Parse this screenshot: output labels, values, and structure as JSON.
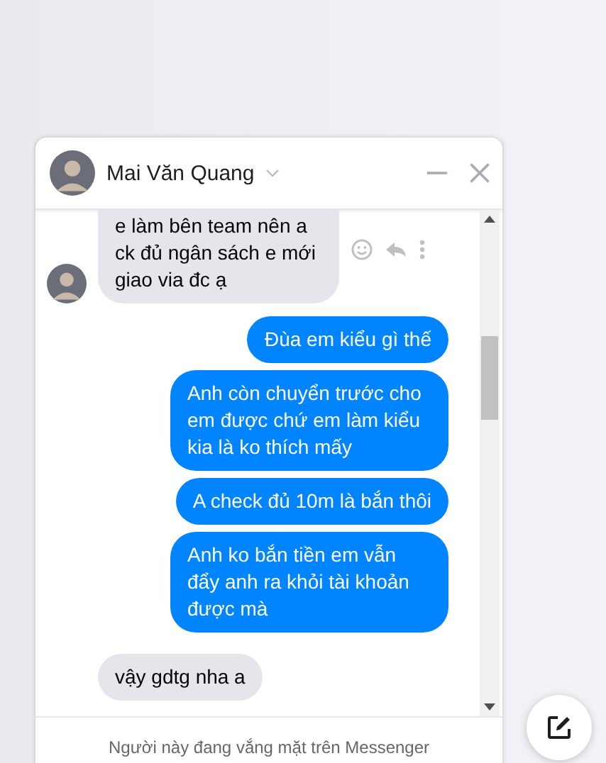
{
  "chat": {
    "contact_name": "Mai Văn Quang"
  },
  "messages": [
    {
      "kind": "incoming",
      "text": "e làm bên team nên a ck đủ ngân sách e mới giao via đc ạ",
      "show_avatar": true,
      "show_actions": true
    },
    {
      "kind": "outgoing",
      "text": "Đùa em kiểu gì thế"
    },
    {
      "kind": "outgoing",
      "text": "Anh còn chuyển trước cho em được chứ em làm kiểu kia là ko thích mấy"
    },
    {
      "kind": "outgoing",
      "text": "A check đủ 10m là bắn thôi"
    },
    {
      "kind": "outgoing",
      "text": "Anh ko bắn tiền em vẫn đẩy anh ra khỏi tài khoản được mà"
    },
    {
      "kind": "incoming",
      "text": "vậy gdtg nha a",
      "show_avatar": false,
      "show_actions": false
    }
  ],
  "footer": {
    "status_text": "Người này đang vắng mặt trên Messenger"
  }
}
